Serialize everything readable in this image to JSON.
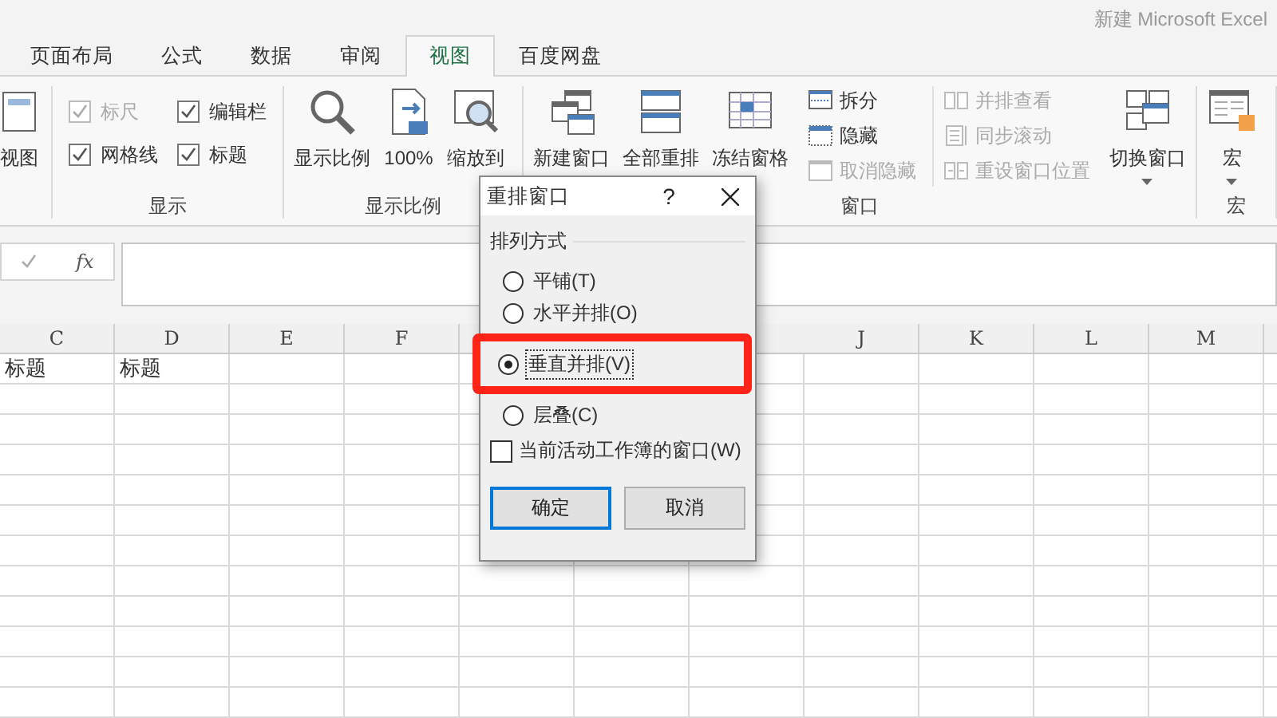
{
  "window": {
    "title": "新建 Microsoft Excel"
  },
  "tabs": [
    {
      "label": "页面布局",
      "selected": false
    },
    {
      "label": "公式",
      "selected": false
    },
    {
      "label": "数据",
      "selected": false
    },
    {
      "label": "审阅",
      "selected": false
    },
    {
      "label": "视图",
      "selected": true
    },
    {
      "label": "百度网盘",
      "selected": false
    }
  ],
  "ribbon": {
    "groups": [
      {
        "kind": "partial",
        "items": [
          {
            "kind": "large",
            "label": "视图",
            "disabled": false
          }
        ]
      },
      {
        "kind": "checks",
        "label": "显示",
        "items": [
          {
            "label": "标尺",
            "checked": true,
            "disabled": true
          },
          {
            "label": "编辑栏",
            "checked": true,
            "disabled": false
          },
          {
            "label": "网格线",
            "checked": true,
            "disabled": false
          },
          {
            "label": "标题",
            "checked": true,
            "disabled": false
          }
        ]
      },
      {
        "kind": "buttons",
        "label": "显示比例",
        "items": [
          {
            "kind": "large",
            "label": "显示比例",
            "disabled": false
          },
          {
            "kind": "large",
            "label": "100%",
            "disabled": false
          },
          {
            "kind": "large",
            "label": "缩放到",
            "disabled": false
          }
        ]
      },
      {
        "kind": "buttons",
        "label": "窗口",
        "items": [
          {
            "kind": "large",
            "label": "新建窗口",
            "disabled": false
          },
          {
            "kind": "large",
            "label": "全部重排",
            "disabled": false
          },
          {
            "kind": "large",
            "label": "冻结窗格",
            "disabled": false
          },
          {
            "kind": "stack",
            "items": [
              {
                "label": "拆分",
                "disabled": false
              },
              {
                "label": "隐藏",
                "disabled": false
              },
              {
                "label": "取消隐藏",
                "disabled": true
              }
            ]
          },
          {
            "kind": "stack",
            "items": [
              {
                "label": "并排查看",
                "disabled": true
              },
              {
                "label": "同步滚动",
                "disabled": true
              },
              {
                "label": "重设窗口位置",
                "disabled": true
              }
            ]
          },
          {
            "kind": "large",
            "label": "切换窗口",
            "caret": true,
            "disabled": false
          }
        ]
      },
      {
        "kind": "buttons",
        "label": "宏",
        "items": [
          {
            "kind": "large",
            "label": "宏",
            "caret": true,
            "disabled": false
          }
        ]
      }
    ]
  },
  "formula_bar": {
    "fx": "fx"
  },
  "sheet": {
    "columns_left": [
      "C",
      "D",
      "E",
      "F"
    ],
    "columns_right": [
      "J",
      "K",
      "L",
      "M"
    ],
    "rows": [
      [
        "标题",
        "标题"
      ]
    ]
  },
  "dialog": {
    "title": "重排窗口",
    "help": "?",
    "section": "排列方式",
    "options": [
      {
        "label": "平铺(T)",
        "selected": false,
        "highlighted": false
      },
      {
        "label": "水平并排(O)",
        "selected": false,
        "highlighted": false
      },
      {
        "label": "垂直并排(V)",
        "selected": true,
        "highlighted": true
      },
      {
        "label": "层叠(C)",
        "selected": false,
        "highlighted": false
      }
    ],
    "checkbox": {
      "label": "当前活动工作簿的窗口(W)",
      "checked": false
    },
    "buttons": [
      {
        "label": "确定",
        "default": true
      },
      {
        "label": "取消",
        "default": false
      }
    ]
  }
}
